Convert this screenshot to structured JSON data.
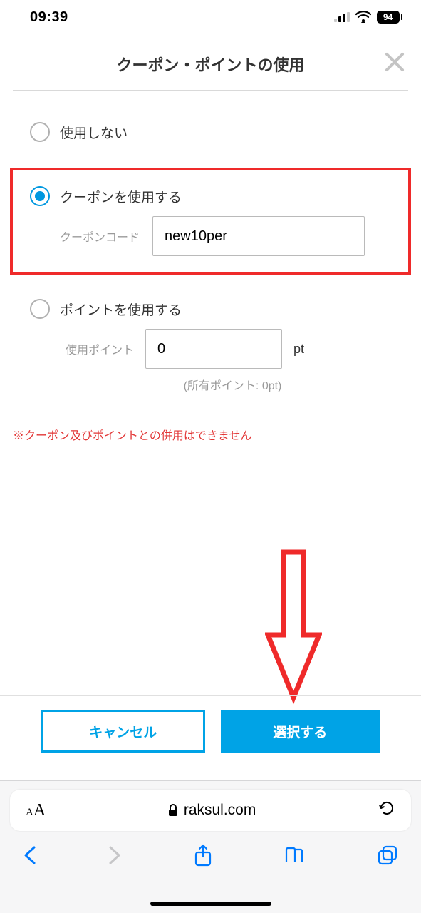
{
  "status": {
    "time": "09:39",
    "battery": "94"
  },
  "header": {
    "title": "クーポン・ポイントの使用"
  },
  "options": {
    "none": {
      "label": "使用しない"
    },
    "coupon": {
      "label": "クーポンを使用する",
      "field_label": "クーポンコード",
      "value": "new10per"
    },
    "points": {
      "label": "ポイントを使用する",
      "field_label": "使用ポイント",
      "value": "0",
      "suffix": "pt",
      "owned": "(所有ポイント: 0pt)"
    }
  },
  "warning": "※クーポン及びポイントとの併用はできません",
  "buttons": {
    "cancel": "キャンセル",
    "select": "選択する"
  },
  "browser": {
    "url": "raksul.com"
  }
}
